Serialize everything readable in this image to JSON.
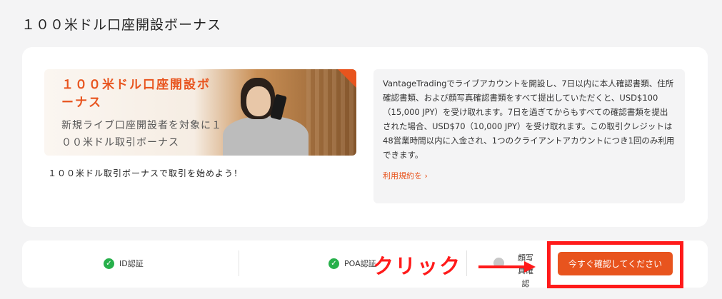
{
  "page": {
    "title": "１００米ドル口座開設ボーナス"
  },
  "banner": {
    "title": "１００米ドル口座開設ボーナス",
    "subtitle": "新規ライブ口座開設者を対象に１００米ドル取引ボーナス",
    "caption": "１００米ドル取引ボーナスで取引を始めよう！"
  },
  "info": {
    "description": "VantageTradingでライブアカウントを開設し、7日以内に本人確認書類、住所確認書類、および顔写真確認書類をすべて提出していただくと、USD$100（15,000 JPY）を受け取れます。7日を過ぎてからもすべての確認書類を提出された場合、USD$70（10,000 JPY）を受け取れます。この取引クレジットは48営業時間以内に入金され、1つのクライアントアカウントにつき1回のみ利用できます。",
    "terms_link": "利用規約を ›"
  },
  "steps": [
    {
      "label": "ID認証",
      "status": "complete",
      "icon": "check-icon"
    },
    {
      "label": "POA認証",
      "status": "complete",
      "icon": "check-icon"
    },
    {
      "label": "顔写真確認",
      "status": "pending",
      "icon": "pending-icon"
    }
  ],
  "actions": {
    "confirm_button": "今すぐ確認してください"
  },
  "annotation": {
    "click_label": "クリック",
    "arrow_icon": "right-arrow-icon"
  },
  "colors": {
    "accent": "#e8541e",
    "success": "#27b04b",
    "annotation_red": "#ff1a1a"
  }
}
